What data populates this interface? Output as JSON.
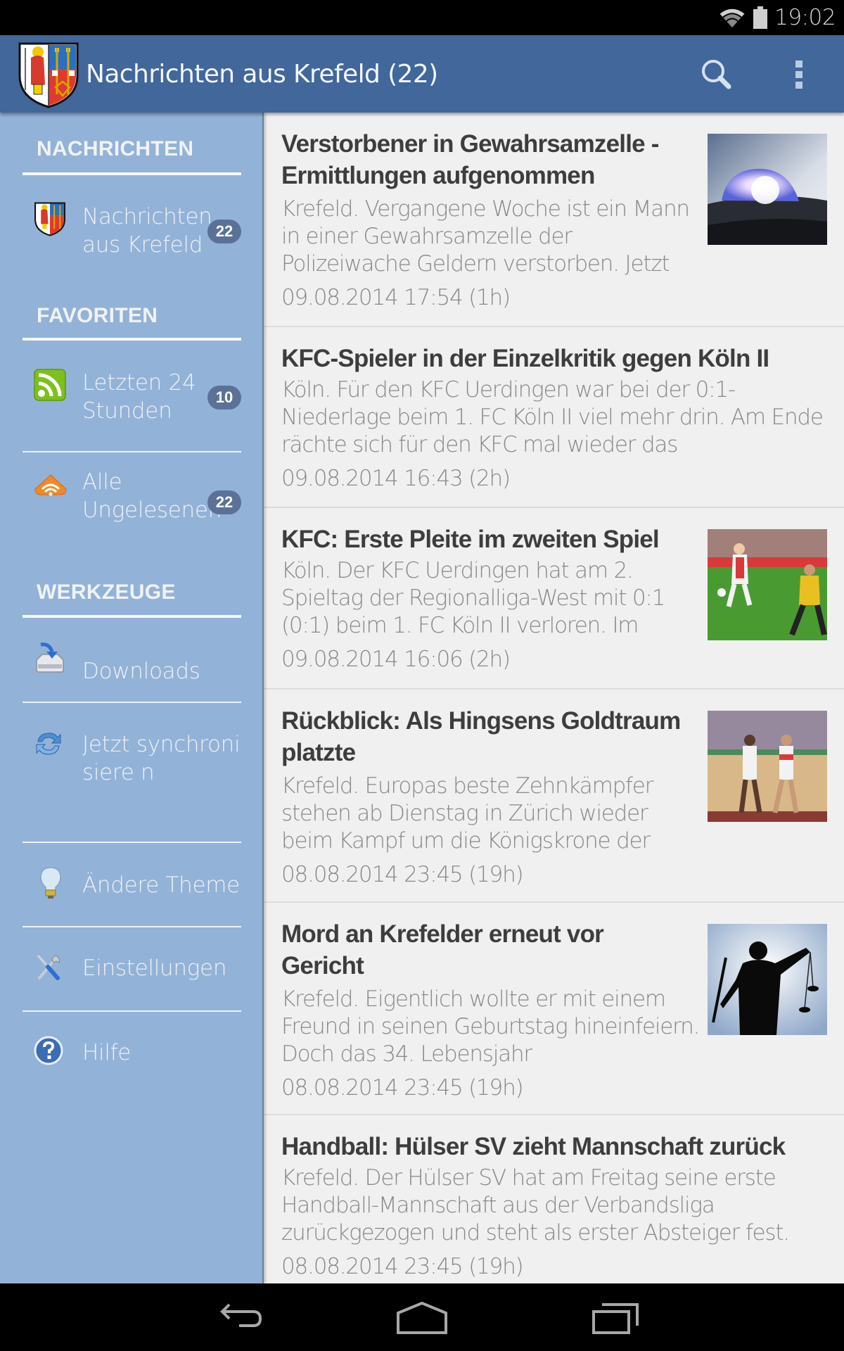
{
  "status_bar": {
    "time": "19:02",
    "icons": [
      "wifi-icon",
      "battery-icon"
    ]
  },
  "toolbar": {
    "logo": "krefeld-coat-of-arms-icon",
    "title": "Nachrichten aus Krefeld (22)",
    "actions": [
      {
        "name": "search",
        "icon": "search-icon"
      },
      {
        "name": "overflow-menu",
        "icon": "more-vertical-icon"
      }
    ]
  },
  "drawer": {
    "sections": [
      {
        "header": "NACHRICHTEN",
        "items": [
          {
            "label": "Nachrichten aus Krefeld",
            "icon": "krefeld-coat-of-arms-icon",
            "badge": "22"
          }
        ]
      },
      {
        "header": "FAVORITEN",
        "items": [
          {
            "label": "Letzten 24 Stunden",
            "icon": "rss-feed-icon",
            "badge": "10"
          },
          {
            "label": "Alle Ungelesenen",
            "icon": "unread-feed-icon",
            "badge": "22"
          }
        ]
      },
      {
        "header": "WERKZEUGE",
        "items": [
          {
            "label": "Downloads",
            "icon": "download-icon"
          },
          {
            "label": "Jetzt synchronisiere n",
            "icon": "sync-icon"
          },
          {
            "label": "Ändere Theme",
            "icon": "lightbulb-icon"
          },
          {
            "label": "Einstellungen",
            "icon": "tools-icon"
          },
          {
            "label": "Hilfe",
            "icon": "help-icon"
          }
        ]
      }
    ]
  },
  "articles": [
    {
      "title": "Verstorbener in Gewahrsamzelle - Ermittlungen aufgenommen",
      "snippet": "Krefeld. Vergangene Woche ist ein Mann in einer Gewahrsamzelle der Polizeiwache Geldern verstorben. Jetzt",
      "date": "09.08.2014 17:54 (1h)",
      "thumbnail": "police-siren-photo"
    },
    {
      "title": "KFC-Spieler in der Einzelkritik gegen Köln II",
      "snippet": "Köln. Für den KFC Uerdingen war bei der 0:1-Niederlage beim 1. FC Köln II viel mehr drin. Am Ende rächte sich für den KFC mal wieder das",
      "date": "09.08.2014 16:43 (2h)",
      "thumbnail": null
    },
    {
      "title": "KFC: Erste Pleite im zweiten Spiel",
      "snippet": "Köln. Der KFC Uerdingen hat am 2. Spieltag der Regionalliga-West mit 0:1 (0:1) beim 1. FC Köln II verloren. Im",
      "date": "09.08.2014 16:06 (2h)",
      "thumbnail": "football-match-photo"
    },
    {
      "title": "Rückblick: Als Hingsens Goldtraum platzte",
      "snippet": "Krefeld. Europas beste Zehnkämpfer stehen ab Dienstag in Zürich wieder beim Kampf um die Königskrone der",
      "date": "08.08.2014 23:45 (19h)",
      "thumbnail": "athletes-stadium-photo"
    },
    {
      "title": "Mord an Krefelder erneut vor Gericht",
      "snippet": "Krefeld. Eigentlich wollte er mit einem Freund in seinen Geburtstag hineinfeiern. Doch das 34. Lebensjahr",
      "date": "08.08.2014 23:45 (19h)",
      "thumbnail": "justitia-silhouette-photo"
    },
    {
      "title": "Handball: Hülser SV zieht Mannschaft zurück",
      "snippet": "Krefeld. Der Hülser SV hat am Freitag seine erste Handball-Mannschaft aus der Verbandsliga zurückgezogen und steht als erster Absteiger fest.",
      "date": "08.08.2014 23:45 (19h)",
      "thumbnail": null
    }
  ],
  "nav_bar": {
    "buttons": [
      "back-icon",
      "home-icon",
      "recent-apps-icon"
    ]
  },
  "colors": {
    "toolbar": "#41679b",
    "drawer": "#93b2d7",
    "badge": "#5b7197",
    "content_bg": "#f0f0f0",
    "title_text": "#3d3d3d",
    "body_text": "#888888"
  }
}
